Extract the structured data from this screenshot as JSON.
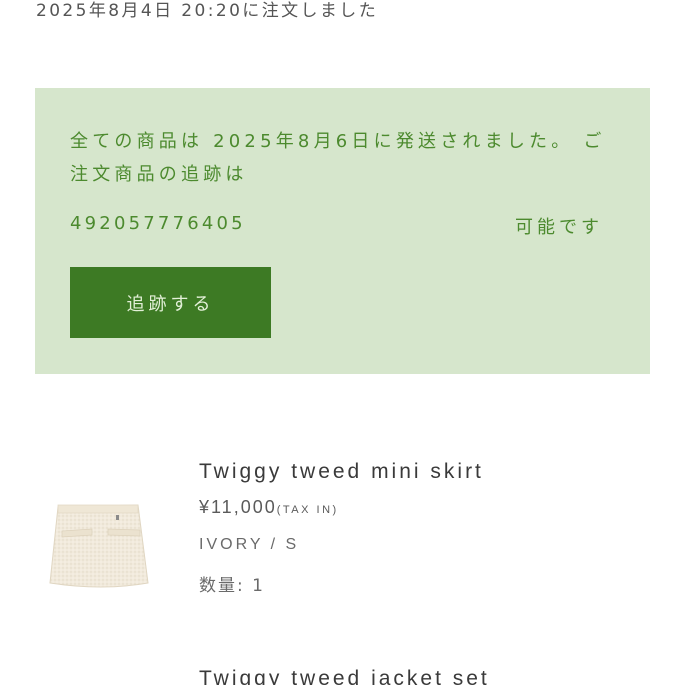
{
  "order": {
    "date_text": "2025年8月4日 20:20に注文しました"
  },
  "shipping": {
    "message": "全ての商品は 2025年8月6日に発送されました。 ご注文商品の追跡は",
    "tracking_number": "492057776405",
    "possible_text": "可能です",
    "track_button_label": "追跡する",
    "background_color": "#d6e6cc",
    "accent_color": "#4c8a2e",
    "button_color": "#3d7a24"
  },
  "items": [
    {
      "name": "Twiggy tweed mini skirt",
      "price": "¥11,000",
      "tax_label": "(TAX IN)",
      "variant": "IVORY / S",
      "quantity": "数量: 1",
      "image": "ivory-tweed-mini-skirt"
    },
    {
      "name": "Twiggy tweed jacket set"
    }
  ]
}
